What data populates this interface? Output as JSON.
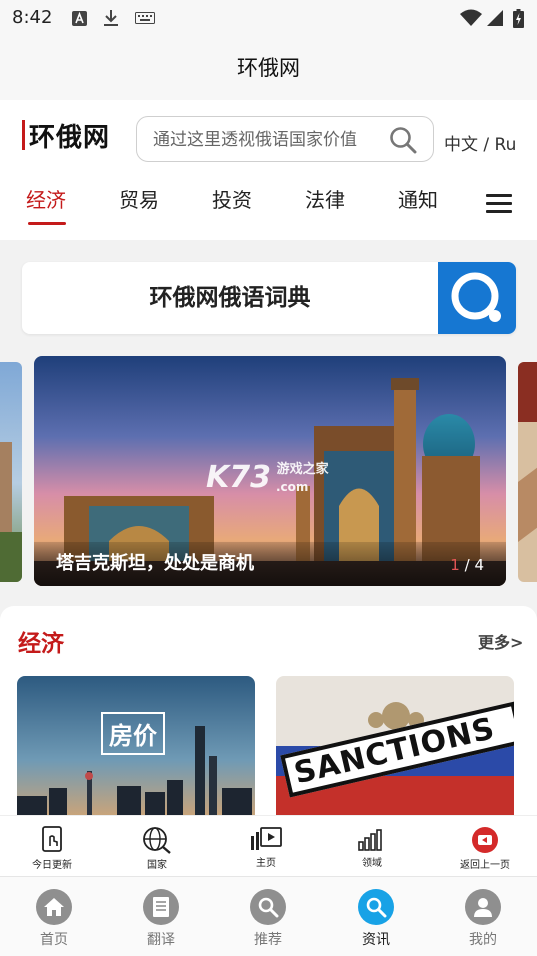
{
  "status_bar": {
    "time": "8:42"
  },
  "app_title": "环俄网",
  "header": {
    "logo_text": "环俄网",
    "search_placeholder": "通过这里透视俄语国家价值",
    "lang_switch": "中文 / Ru"
  },
  "tabs": [
    {
      "label": "经济",
      "active": true
    },
    {
      "label": "贸易",
      "active": false
    },
    {
      "label": "投资",
      "active": false
    },
    {
      "label": "法律",
      "active": false
    },
    {
      "label": "通知",
      "active": false
    }
  ],
  "dictionary": {
    "title": "环俄网俄语词典"
  },
  "banner": {
    "caption": "塔吉克斯坦，处处是商机",
    "page_current": "1",
    "page_total": "/ 4",
    "watermark_main": "K73",
    "watermark_sub": "游戏之家",
    "watermark_domain": ".com"
  },
  "section": {
    "title": "经济",
    "more_label": "更多>",
    "cards": [
      {
        "overlay_text": "房价"
      },
      {
        "overlay_text": "SANCTIONS"
      }
    ]
  },
  "quick_links": [
    {
      "label": "今日更新",
      "icon": "tablet-touch-icon"
    },
    {
      "label": "国家",
      "icon": "globe-icon"
    },
    {
      "label": "主页",
      "icon": "play-screen-icon"
    },
    {
      "label": "领域",
      "icon": "signal-bars-icon"
    },
    {
      "label": "返回上一页",
      "icon": "back-button-icon"
    }
  ],
  "bottom_nav": [
    {
      "label": "首页",
      "icon": "home-icon",
      "active": false
    },
    {
      "label": "翻译",
      "icon": "document-icon",
      "active": false
    },
    {
      "label": "推荐",
      "icon": "search-icon",
      "active": false
    },
    {
      "label": "资讯",
      "icon": "search-icon",
      "active": true
    },
    {
      "label": "我的",
      "icon": "person-icon",
      "active": false
    }
  ],
  "colors": {
    "brand_red": "#c41a1a",
    "dict_blue": "#1677d2",
    "nav_active": "#18a2e6",
    "nav_inactive": "#8f8f8f"
  }
}
